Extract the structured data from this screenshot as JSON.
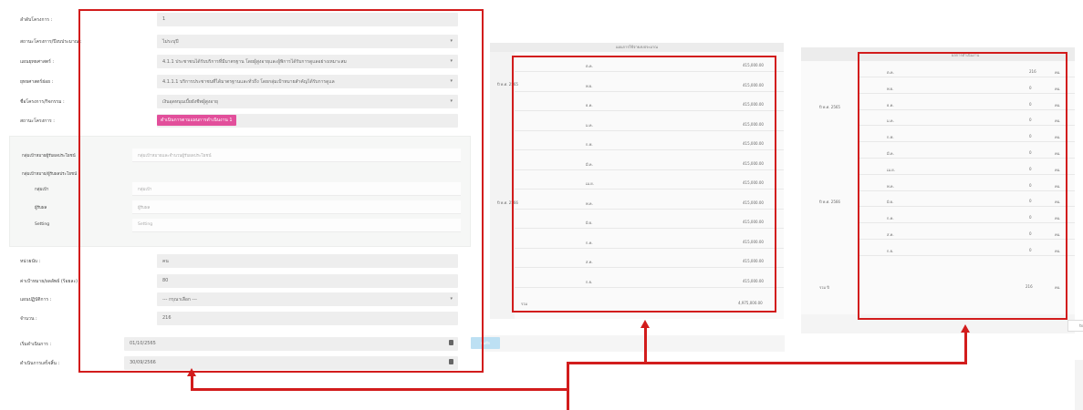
{
  "form": {
    "rows": [
      {
        "label": "ลำดับโครงการ :",
        "value": "1"
      },
      {
        "label": "สถานะโครงการ/ปีงบประมาณ :",
        "value": "ไม่ระบุปี",
        "has_caret": true
      },
      {
        "label": "แผนยุทธศาสตร์ :",
        "value": "4.1.1 ประชาชนได้รับบริการที่มีมาตรฐาน โดยผู้สูงอายุและผู้พิการได้รับการดูแลอย่างเหมาะสม",
        "has_caret": true
      },
      {
        "label": "ยุทธศาสตร์ย่อย :",
        "value": "4.1.1.1 บริการประชาชนที่ได้มาตรฐานและทั่วถึง โดยกลุ่มเป้าหมายสำคัญได้รับการดูแล",
        "has_caret": true
      },
      {
        "label": "ชื่อโครงการ/กิจกรรม :",
        "value": "เงินอุดหนุนเบี้ยยังชีพผู้สูงอายุ",
        "has_caret": true
      },
      {
        "label": "สถานะโครงการ :",
        "badge": "ดำเนินการตามแผนการดำเนินงาน 1"
      }
    ],
    "subpanel": {
      "heading1": "กลุ่มเป้าหมายผู้รับผลประโยชน์",
      "heading1_placeholder": "กลุ่มเป้าหมายและจำนวนผู้รับผลประโยชน์",
      "heading2": "กลุ่มเป้าหมาย/ผู้รับผลประโยชน์",
      "fields": [
        {
          "label": "กลุ่มเป้า",
          "placeholder": "กลุ่มเป้า"
        },
        {
          "label": "ผู้รับผล",
          "placeholder": "ผู้รับผล"
        },
        {
          "label": "Setting",
          "placeholder": "Setting"
        }
      ]
    },
    "rows2": [
      {
        "label": "หน่วยนับ :",
        "value": "คน"
      },
      {
        "label": "ค่าเป้าหมาย/ผลลัพธ์ (ร้อยละ) :",
        "value": "80"
      },
      {
        "label": "แผนปฏิบัติการ :",
        "value": "--- กรุณาเลือก ---",
        "has_caret": true
      },
      {
        "label": "จำนวน :",
        "value": "216"
      }
    ],
    "dates": [
      {
        "label": "เริ่มดำเนินการ :",
        "value": "01/10/2565"
      },
      {
        "label": "ดำเนินการเสร็จสิ้น :",
        "value": "30/09/2566"
      }
    ],
    "save_label": "บันทึก"
  },
  "middle_table": {
    "title": "แผนการใช้จ่ายงบประมาณ",
    "year_labels": [
      "ปี พ.ศ. 2565",
      "ปี พ.ศ. 2566"
    ],
    "months": [
      "ต.ค.",
      "พ.ย.",
      "ธ.ค.",
      "ม.ค.",
      "ก.พ.",
      "มี.ค.",
      "เม.ย.",
      "พ.ค.",
      "มิ.ย.",
      "ก.ค.",
      "ส.ค.",
      "ก.ย."
    ],
    "amounts": [
      "415,000.00",
      "415,000.00",
      "415,000.00",
      "415,000.00",
      "415,000.00",
      "415,000.00",
      "415,000.00",
      "415,000.00",
      "415,000.00",
      "415,000.00",
      "415,000.00",
      "415,000.00"
    ],
    "total_label": "รวม",
    "total_value": "4,975,000.00"
  },
  "right_table": {
    "title": "ผลการดำเนินงาน",
    "year_labels": [
      "ปี พ.ศ. 2565",
      "ปี พ.ศ. 2566"
    ],
    "months": [
      "ต.ค.",
      "พ.ย.",
      "ธ.ค.",
      "ม.ค.",
      "ก.พ.",
      "มี.ค.",
      "เม.ย.",
      "พ.ค.",
      "มิ.ย.",
      "ก.ค.",
      "ส.ค.",
      "ก.ย."
    ],
    "values": [
      "216",
      "0",
      "0",
      "0",
      "0",
      "0",
      "0",
      "0",
      "0",
      "0",
      "0",
      "0"
    ],
    "unit": "คน",
    "total_label": "รวม ปี",
    "total_value": "216",
    "button_label": "ปิด"
  },
  "colors": {
    "annotation_red": "#d21c1c",
    "badge_pink": "#e24f9b",
    "save_button": "#bde0f3"
  }
}
